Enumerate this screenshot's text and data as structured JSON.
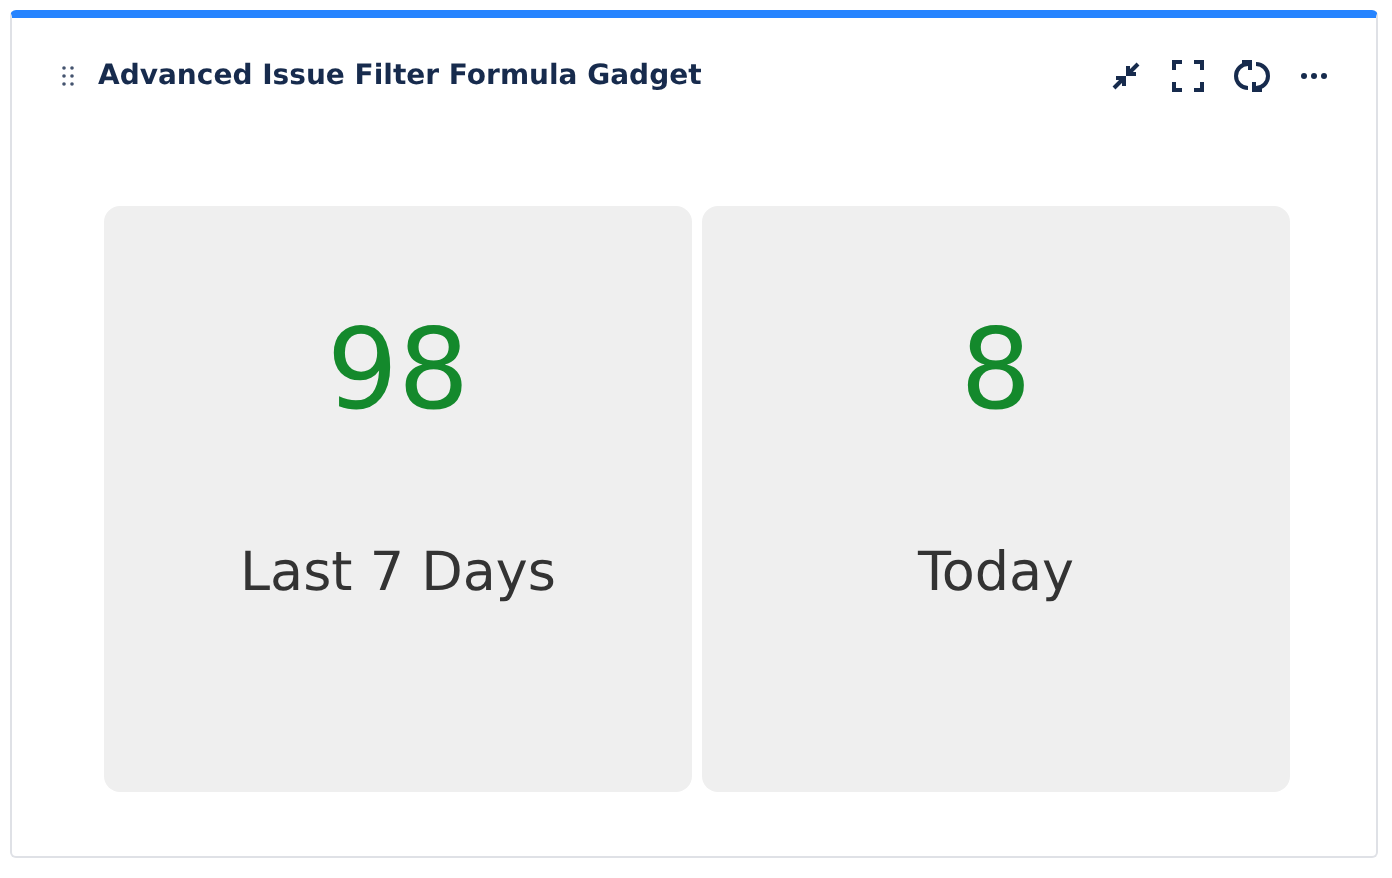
{
  "gadget": {
    "title": "Advanced Issue Filter Formula Gadget"
  },
  "tiles": [
    {
      "value": "98",
      "label": "Last 7 Days",
      "color": "#14892c"
    },
    {
      "value": "8",
      "label": "Today",
      "color": "#14892c"
    }
  ]
}
